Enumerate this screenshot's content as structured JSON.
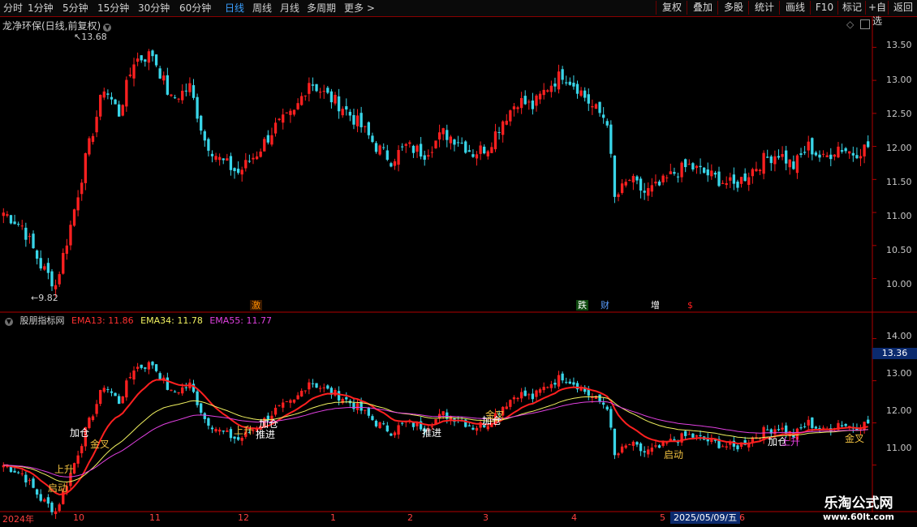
{
  "toolbar": {
    "tabs": [
      {
        "label": "分时"
      },
      {
        "label": "1分钟"
      },
      {
        "label": "5分钟"
      },
      {
        "label": "15分钟"
      },
      {
        "label": "30分钟"
      },
      {
        "label": "60分钟"
      },
      {
        "label": "日线"
      },
      {
        "label": "周线"
      },
      {
        "label": "月线"
      },
      {
        "label": "多周期"
      },
      {
        "label": "更多 >"
      }
    ],
    "active_tab": "日线",
    "buttons": [
      {
        "label": "复权"
      },
      {
        "label": "叠加"
      },
      {
        "label": "多股"
      },
      {
        "label": "统计"
      },
      {
        "label": "画线"
      },
      {
        "label": "F10"
      },
      {
        "label": "标记"
      },
      {
        "label": "+自选"
      },
      {
        "label": "返回"
      }
    ]
  },
  "main": {
    "title": "龙净环保(日线,前复权)",
    "high_label": "13.68",
    "low_label": "9.82",
    "price_axis": [
      "13.50",
      "13.00",
      "12.50",
      "12.00",
      "11.50",
      "11.00",
      "10.50",
      "10.00"
    ],
    "event_tags": [
      {
        "text": "激",
        "color": "#ff8c00"
      },
      {
        "text": "跌",
        "color": "#1e9e1e"
      },
      {
        "text": "财",
        "color": "#3a7cff"
      },
      {
        "text": "增",
        "color": "#ff3030"
      },
      {
        "text": "$",
        "color": "#ff2020"
      }
    ]
  },
  "indicator": {
    "name": "股朋指标网",
    "ema13_label": "EMA13: 11.86",
    "ema34_label": "EMA34: 11.78",
    "ema55_label": "EMA55: 11.77",
    "axis": [
      "14.00",
      "13.00",
      "12.00",
      "11.00"
    ],
    "current_value": "13.36",
    "signals": [
      {
        "text": "加仓",
        "color": "#ffffff"
      },
      {
        "text": "金叉",
        "color": "#f0c040"
      },
      {
        "text": "上升",
        "color": "#f0c040"
      },
      {
        "text": "启动",
        "color": "#f0c040"
      },
      {
        "text": "上升",
        "color": "#f0c040"
      },
      {
        "text": "加仓",
        "color": "#ffffff"
      },
      {
        "text": "推进",
        "color": "#ffffff"
      },
      {
        "text": "推进",
        "color": "#ffffff"
      },
      {
        "text": "加仓",
        "color": "#ffffff"
      },
      {
        "text": "金叉",
        "color": "#f0c040"
      },
      {
        "text": "启动",
        "color": "#f0c040"
      },
      {
        "text": "加仓",
        "color": "#ffffff"
      },
      {
        "text": "上升",
        "color": "#e040e0"
      },
      {
        "text": "金叉",
        "color": "#f0c040"
      }
    ]
  },
  "time_axis": {
    "labels": [
      "2024年",
      "10",
      "11",
      "12",
      "1",
      "2",
      "3",
      "4",
      "5",
      "6"
    ],
    "highlight": "2025/05/09/五"
  },
  "watermark": {
    "cn": "乐淘公式网",
    "url": "www.60lt.com"
  },
  "chart_data": {
    "type": "candlestick",
    "y_range_main": [
      9.7,
      13.75
    ],
    "y_range_indicator": [
      10.3,
      14.3
    ],
    "colors": {
      "up": "#ff2020",
      "down": "#39d5e8",
      "ema13": "#ff2020",
      "ema34": "#f2f260",
      "ema55": "#e040e0"
    },
    "anchors": [
      [
        0,
        11.0
      ],
      [
        5,
        10.8
      ],
      [
        10,
        10.2
      ],
      [
        14,
        9.9
      ],
      [
        18,
        10.8
      ],
      [
        22,
        11.8
      ],
      [
        27,
        12.9
      ],
      [
        31,
        12.5
      ],
      [
        35,
        13.3
      ],
      [
        40,
        13.4
      ],
      [
        45,
        12.7
      ],
      [
        50,
        12.9
      ],
      [
        54,
        12.1
      ],
      [
        58,
        11.8
      ],
      [
        63,
        11.6
      ],
      [
        68,
        11.9
      ],
      [
        73,
        12.3
      ],
      [
        78,
        12.5
      ],
      [
        82,
        13.0
      ],
      [
        86,
        12.8
      ],
      [
        91,
        12.6
      ],
      [
        96,
        12.3
      ],
      [
        100,
        12.0
      ],
      [
        104,
        11.8
      ],
      [
        108,
        12.0
      ],
      [
        113,
        11.9
      ],
      [
        118,
        12.2
      ],
      [
        122,
        12.1
      ],
      [
        126,
        11.9
      ],
      [
        130,
        12.0
      ],
      [
        134,
        12.4
      ],
      [
        138,
        12.7
      ],
      [
        142,
        12.6
      ],
      [
        146,
        12.9
      ],
      [
        150,
        13.1
      ],
      [
        154,
        12.9
      ],
      [
        158,
        12.6
      ],
      [
        162,
        12.4
      ],
      [
        164,
        11.2
      ],
      [
        168,
        11.5
      ],
      [
        172,
        11.3
      ],
      [
        176,
        11.4
      ],
      [
        180,
        11.6
      ],
      [
        184,
        11.7
      ],
      [
        188,
        11.6
      ],
      [
        192,
        11.5
      ],
      [
        196,
        11.4
      ],
      [
        200,
        11.6
      ],
      [
        204,
        11.8
      ],
      [
        208,
        11.9
      ],
      [
        212,
        11.7
      ],
      [
        216,
        12.0
      ],
      [
        220,
        11.8
      ],
      [
        224,
        12.0
      ],
      [
        228,
        11.9
      ],
      [
        232,
        12.0
      ]
    ],
    "n": 233
  }
}
